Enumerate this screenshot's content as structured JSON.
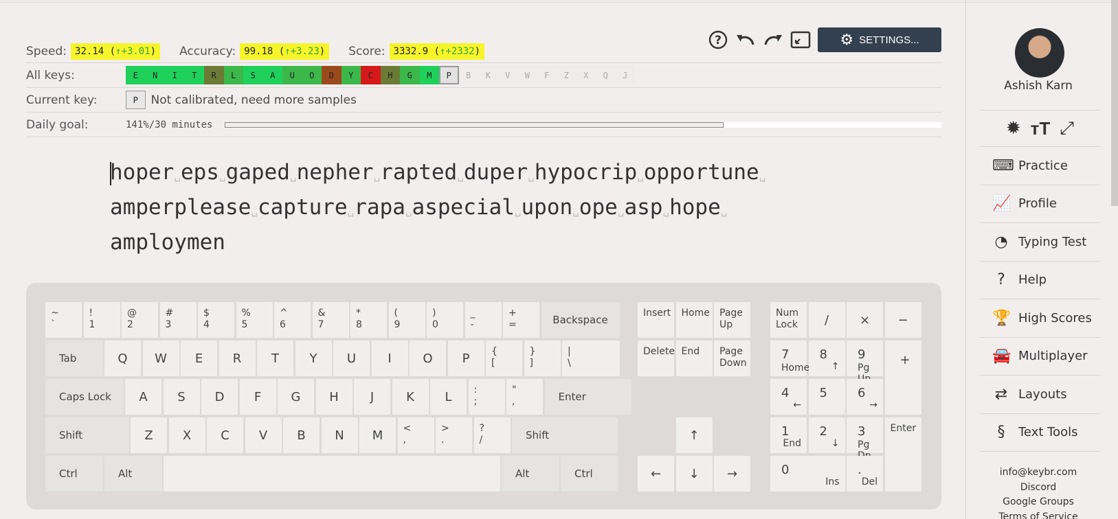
{
  "stats": {
    "speed_label": "Speed:",
    "speed_value": "32.14",
    "speed_delta": "↑+3.01",
    "accuracy_label": "Accuracy:",
    "accuracy_value": "99.18",
    "accuracy_delta": "↑+3.23",
    "score_label": "Score:",
    "score_value": "3332.9",
    "score_delta": "↑+2332"
  },
  "toolbar": {
    "settings_label": "SETTINGS..."
  },
  "all_keys": {
    "label": "All keys:",
    "keys": [
      {
        "k": "E",
        "color": "#1fd15b"
      },
      {
        "k": "N",
        "color": "#1fd15b"
      },
      {
        "k": "I",
        "color": "#1fd15b"
      },
      {
        "k": "T",
        "color": "#1fd15b"
      },
      {
        "k": "R",
        "color": "#6b7b36"
      },
      {
        "k": "L",
        "color": "#3cb84a"
      },
      {
        "k": "S",
        "color": "#1fd15b"
      },
      {
        "k": "A",
        "color": "#1fd15b"
      },
      {
        "k": "U",
        "color": "#3cb84a"
      },
      {
        "k": "O",
        "color": "#3cb84a"
      },
      {
        "k": "D",
        "color": "#9a4a1d"
      },
      {
        "k": "Y",
        "color": "#3cb84a"
      },
      {
        "k": "C",
        "color": "#d61818"
      },
      {
        "k": "H",
        "color": "#6b7b36"
      },
      {
        "k": "G",
        "color": "#3cb84a"
      },
      {
        "k": "M",
        "color": "#1fd15b"
      },
      {
        "k": "P",
        "color": "sel"
      },
      {
        "k": "B",
        "color": "off"
      },
      {
        "k": "K",
        "color": "off"
      },
      {
        "k": "V",
        "color": "off"
      },
      {
        "k": "W",
        "color": "off"
      },
      {
        "k": "F",
        "color": "off"
      },
      {
        "k": "Z",
        "color": "off"
      },
      {
        "k": "X",
        "color": "off"
      },
      {
        "k": "Q",
        "color": "off"
      },
      {
        "k": "J",
        "color": "off"
      }
    ]
  },
  "current_key": {
    "label": "Current key:",
    "key": "P",
    "status": "Not calibrated, need more samples"
  },
  "daily_goal": {
    "label": "Daily goal:",
    "value": "141%/30 minutes",
    "progress": 1.0
  },
  "text_lines": [
    [
      "hoper",
      "eps",
      "gaped",
      "nepher",
      "rapted",
      "duper",
      "hypocrip",
      "opportune"
    ],
    [
      "amperplease",
      "capture",
      "rapa",
      "aspecial",
      "upon",
      "ope",
      "asp",
      "hope"
    ],
    [
      "amploymen"
    ]
  ],
  "user": {
    "name": "Ashish Karn"
  },
  "menu": [
    {
      "icon": "⌨",
      "label": "Practice"
    },
    {
      "icon": "📈",
      "label": "Profile"
    },
    {
      "icon": "◔",
      "label": "Typing Test"
    },
    {
      "icon": "?",
      "label": "Help"
    },
    {
      "icon": "🏆",
      "label": "High Scores"
    },
    {
      "icon": "🚘",
      "label": "Multiplayer"
    },
    {
      "icon": "⇄",
      "label": "Layouts"
    },
    {
      "icon": "§",
      "label": "Text Tools"
    }
  ],
  "footer_links": [
    "info@keybr.com",
    "Discord",
    "Google Groups",
    "Terms of Service"
  ],
  "keyboard": {
    "backspace": "Backspace",
    "tab": "Tab",
    "capslock": "Caps Lock",
    "enter": "Enter",
    "shift": "Shift",
    "ctrl": "Ctrl",
    "alt": "Alt",
    "insert": "Insert",
    "home": "Home",
    "page_up": "Page Up",
    "delete": "Delete",
    "end": "End",
    "page_down": "Page Down",
    "num_lock": "Num Lock"
  }
}
